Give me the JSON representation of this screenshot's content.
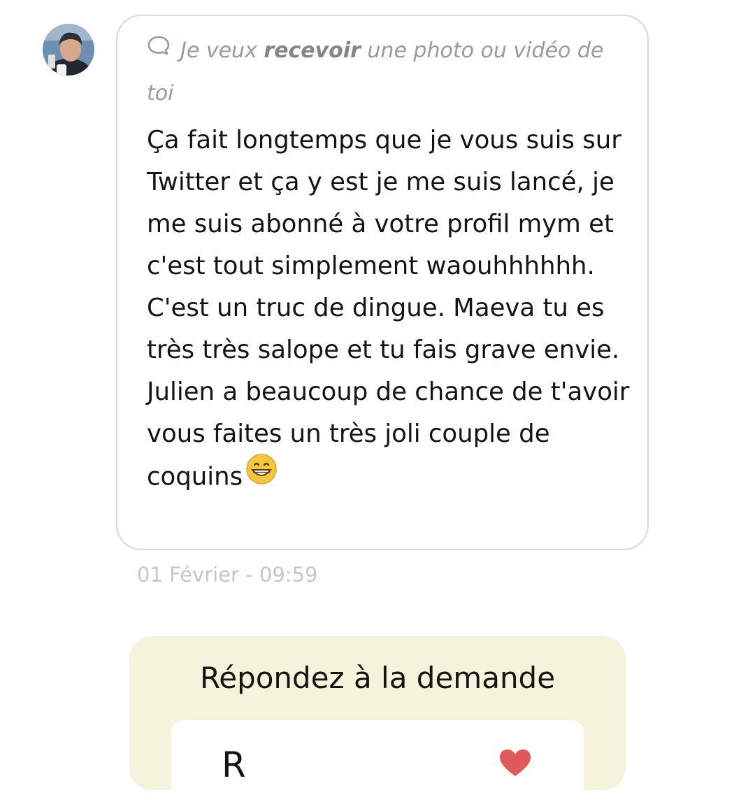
{
  "sender": {
    "avatar_icon": "user-avatar-photo"
  },
  "request": {
    "icon": "speech-bubble-icon",
    "prefix": "Je veux ",
    "action": "recevoir",
    "suffix": " une photo ou vidéo de toi"
  },
  "message": {
    "text": "Ça fait longtemps que je vous suis sur Twitter et ça y est je me suis lancé, je me suis abonné à votre profil mym et c'est tout simplement waouhhhhhh. C'est un truc de dingue. Maeva tu es très très salope et tu fais grave envie. Julien a beaucoup de chance de t'avoir vous faites un très joli couple de coquins",
    "emoji": "grinning-face-emoji",
    "timestamp": "01 Février - 09:59"
  },
  "reply": {
    "title": "Répondez à la demande",
    "option_partial": "R",
    "option_icon": "heart-icon"
  },
  "colors": {
    "bubble_border": "#d9d9d9",
    "muted_text": "#9a9a9a",
    "timestamp": "#c6c6c6",
    "reply_card_bg": "#f4f3dc",
    "heart": "#e05a5a"
  }
}
